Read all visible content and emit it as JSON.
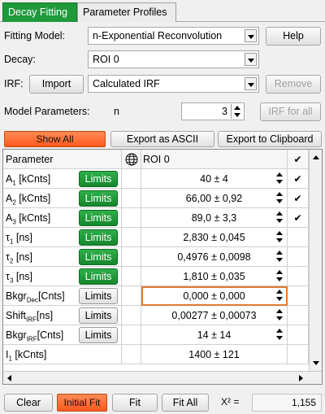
{
  "tabs": [
    {
      "label": "Decay Fitting"
    },
    {
      "label": "Parameter Profiles"
    }
  ],
  "form": {
    "fitting_model_label": "Fitting Model:",
    "fitting_model_value": "n-Exponential Reconvolution",
    "help_label": "Help",
    "decay_label": "Decay:",
    "decay_value": "ROI 0",
    "irf_label": "IRF:",
    "import_label": "Import",
    "irf_value": "Calculated IRF",
    "remove_label": "Remove",
    "model_params_label": "Model Parameters:",
    "n_label": "n",
    "n_value": "3",
    "irf_for_all_label": "IRF for all"
  },
  "actions": {
    "show_all": "Show All",
    "export_ascii": "Export as ASCII",
    "export_clipboard": "Export to Clipboard"
  },
  "grid": {
    "header_param": "Parameter",
    "header_roi": "ROI 0",
    "header_check": "✔",
    "limits_label": "Limits",
    "rows": [
      {
        "name": "A",
        "sub": "1",
        "unit": " [kCnts]",
        "value": "40 ± 4",
        "checked": "✔",
        "limits": "green"
      },
      {
        "name": "A",
        "sub": "2",
        "unit": " [kCnts]",
        "value": "66,00 ± 0,92",
        "checked": "✔",
        "limits": "green"
      },
      {
        "name": "A",
        "sub": "3",
        "unit": " [kCnts]",
        "value": "89,0 ± 3,3",
        "checked": "✔",
        "limits": "green"
      },
      {
        "name": "τ",
        "sub": "1",
        "unit": " [ns]",
        "value": "2,830 ± 0,045",
        "checked": "",
        "limits": "green"
      },
      {
        "name": "τ",
        "sub": "2",
        "unit": " [ns]",
        "value": "0,4976 ± 0,0098",
        "checked": "",
        "limits": "green"
      },
      {
        "name": "τ",
        "sub": "3",
        "unit": " [ns]",
        "value": "1,810 ± 0,035",
        "checked": "",
        "limits": "green"
      },
      {
        "name": "Bkgr",
        "sub": "Dec",
        "unit": "[Cnts]",
        "value": "0,000 ± 0,000",
        "checked": "",
        "limits": "gray"
      },
      {
        "name": "Shift",
        "sub": "IRF",
        "unit": "[ns]",
        "value": "0,00277 ± 0,00073",
        "checked": "",
        "limits": "gray"
      },
      {
        "name": "Bkgr",
        "sub": "IRF",
        "unit": "[Cnts]",
        "value": "14 ± 14",
        "checked": "",
        "limits": "gray"
      },
      {
        "name": "I",
        "sub": "1",
        "unit": " [kCnts]",
        "value": "1400 ± 121",
        "checked": "",
        "limits": "none"
      }
    ]
  },
  "bottom": {
    "clear": "Clear",
    "initial_fit": "Initial Fit",
    "fit": "Fit",
    "fit_all": "Fit All",
    "chi_label": "X² =",
    "chi_value": "1,155"
  },
  "colors": {
    "active_tab": "#1e9a3a",
    "limits_green": "#1e9a3a",
    "orange_button": "#ff6a2a",
    "highlight": "#e07a30"
  }
}
